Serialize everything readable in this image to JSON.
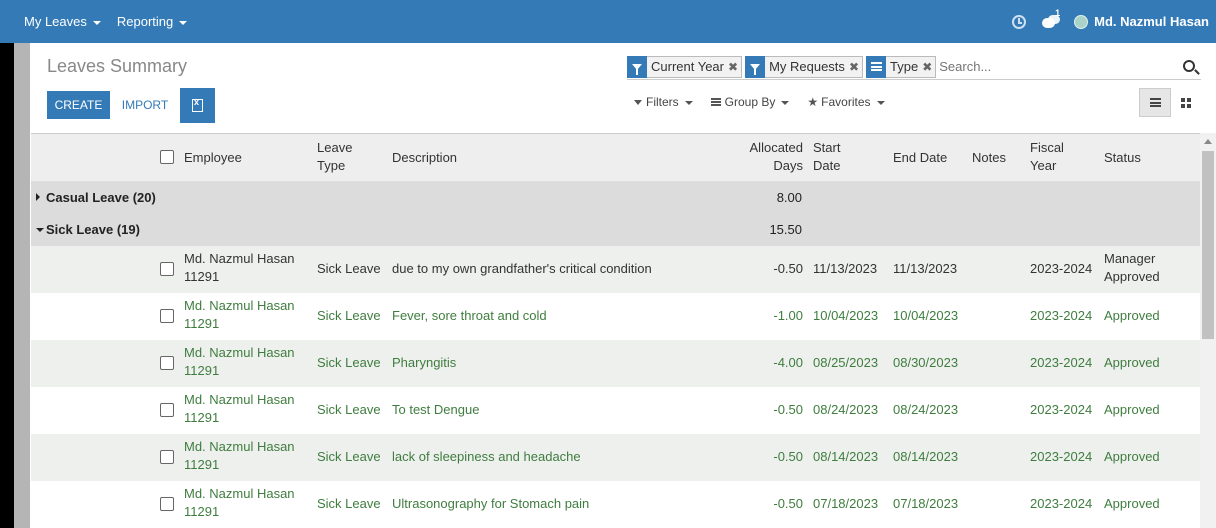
{
  "nav": {
    "menus": [
      {
        "label": "My Leaves"
      },
      {
        "label": "Reporting"
      }
    ],
    "chat_badge": "1",
    "user_name": "Md. Nazmul Hasan"
  },
  "control": {
    "title": "Leaves Summary",
    "create_label": "CREATE",
    "import_label": "IMPORT"
  },
  "search": {
    "facets": [
      "Current Year",
      "My Requests",
      "Type"
    ],
    "placeholder": "Search...",
    "filters_label": "Filters",
    "groupby_label": "Group By",
    "favorites_label": "Favorites"
  },
  "table": {
    "headers": {
      "employee": "Employee",
      "leave_type_1": "Leave",
      "leave_type_2": "Type",
      "description": "Description",
      "allocated_1": "Allocated",
      "allocated_2": "Days",
      "start_1": "Start",
      "start_2": "Date",
      "end_date": "End Date",
      "notes": "Notes",
      "fiscal_1": "Fiscal",
      "fiscal_2": "Year",
      "status": "Status"
    },
    "groups": [
      {
        "label": "Casual Leave (20)",
        "value": "8.00"
      },
      {
        "label": "Sick Leave (19)",
        "value": "15.50"
      }
    ],
    "rows": [
      {
        "emp1": "Md. Nazmul Hasan",
        "emp2": "11291",
        "type": "Sick Leave",
        "desc": "due to my own grandfather's critical condition",
        "days": "-0.50",
        "start": "11/13/2023",
        "end": "11/13/2023",
        "fiscal": "2023-2024",
        "status1": "Manager",
        "status2": "Approved"
      },
      {
        "emp1": "Md. Nazmul Hasan",
        "emp2": "11291",
        "type": "Sick Leave",
        "desc": "Fever, sore throat and cold",
        "days": "-1.00",
        "start": "10/04/2023",
        "end": "10/04/2023",
        "fiscal": "2023-2024",
        "status1": "Approved",
        "status2": ""
      },
      {
        "emp1": "Md. Nazmul Hasan",
        "emp2": "11291",
        "type": "Sick Leave",
        "desc": "Pharyngitis",
        "days": "-4.00",
        "start": "08/25/2023",
        "end": "08/30/2023",
        "fiscal": "2023-2024",
        "status1": "Approved",
        "status2": ""
      },
      {
        "emp1": "Md. Nazmul Hasan",
        "emp2": "11291",
        "type": "Sick Leave",
        "desc": "To test Dengue",
        "days": "-0.50",
        "start": "08/24/2023",
        "end": "08/24/2023",
        "fiscal": "2023-2024",
        "status1": "Approved",
        "status2": ""
      },
      {
        "emp1": "Md. Nazmul Hasan",
        "emp2": "11291",
        "type": "Sick Leave",
        "desc": "lack of sleepiness and headache",
        "days": "-0.50",
        "start": "08/14/2023",
        "end": "08/14/2023",
        "fiscal": "2023-2024",
        "status1": "Approved",
        "status2": ""
      },
      {
        "emp1": "Md. Nazmul Hasan",
        "emp2": "11291",
        "type": "Sick Leave",
        "desc": "Ultrasonography for Stomach pain",
        "days": "-0.50",
        "start": "07/18/2023",
        "end": "07/18/2023",
        "fiscal": "2023-2024",
        "status1": "Approved",
        "status2": ""
      }
    ]
  },
  "colors": {
    "brand": "#337ab7",
    "approved": "#3f7d3f"
  }
}
